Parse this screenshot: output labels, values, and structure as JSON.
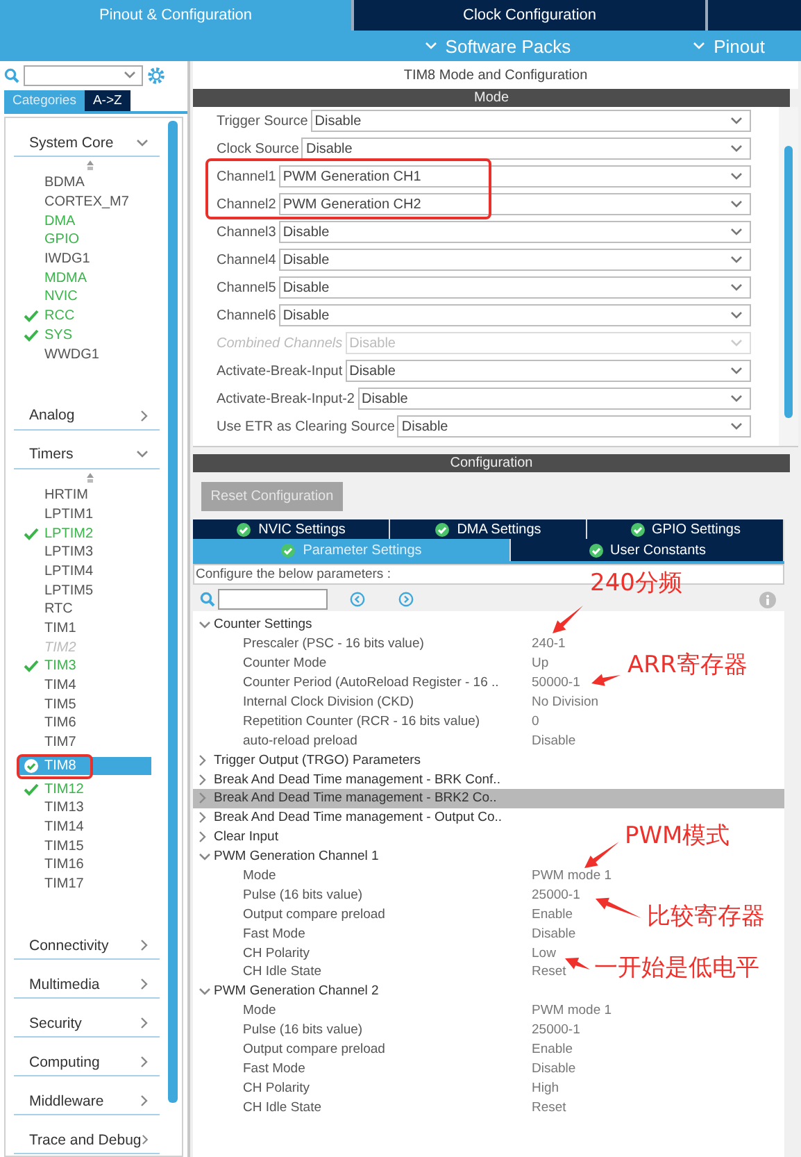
{
  "top_tabs": [
    {
      "label": "Pinout & Configuration",
      "selected": true
    },
    {
      "label": "Clock Configuration",
      "selected": false
    }
  ],
  "menu_bar": [
    "Software Packs",
    "Pinout"
  ],
  "sidebar": {
    "view_tabs": [
      {
        "label": "Categories",
        "selected": true
      },
      {
        "label": "A->Z",
        "selected": false
      }
    ],
    "categories": [
      {
        "name": "System Core",
        "expanded": true,
        "items": [
          {
            "label": "BDMA",
            "active": false,
            "checked": false,
            "disabled": false,
            "selected": false
          },
          {
            "label": "CORTEX_M7",
            "active": false,
            "checked": false,
            "disabled": false,
            "selected": false
          },
          {
            "label": "DMA",
            "active": true,
            "checked": false,
            "disabled": false,
            "selected": false
          },
          {
            "label": "GPIO",
            "active": true,
            "checked": false,
            "disabled": false,
            "selected": false
          },
          {
            "label": "IWDG1",
            "active": false,
            "checked": false,
            "disabled": false,
            "selected": false
          },
          {
            "label": "MDMA",
            "active": true,
            "checked": false,
            "disabled": false,
            "selected": false
          },
          {
            "label": "NVIC",
            "active": true,
            "checked": false,
            "disabled": false,
            "selected": false
          },
          {
            "label": "RCC",
            "active": true,
            "checked": true,
            "disabled": false,
            "selected": false
          },
          {
            "label": "SYS",
            "active": true,
            "checked": true,
            "disabled": false,
            "selected": false
          },
          {
            "label": "WWDG1",
            "active": false,
            "checked": false,
            "disabled": false,
            "selected": false
          }
        ]
      },
      {
        "name": "Analog",
        "expanded": false
      },
      {
        "name": "Timers",
        "expanded": true,
        "items": [
          {
            "label": "HRTIM",
            "active": false,
            "checked": false,
            "disabled": false,
            "selected": false
          },
          {
            "label": "LPTIM1",
            "active": false,
            "checked": false,
            "disabled": false,
            "selected": false
          },
          {
            "label": "LPTIM2",
            "active": true,
            "checked": true,
            "disabled": false,
            "selected": false
          },
          {
            "label": "LPTIM3",
            "active": false,
            "checked": false,
            "disabled": false,
            "selected": false
          },
          {
            "label": "LPTIM4",
            "active": false,
            "checked": false,
            "disabled": false,
            "selected": false
          },
          {
            "label": "LPTIM5",
            "active": false,
            "checked": false,
            "disabled": false,
            "selected": false
          },
          {
            "label": "RTC",
            "active": false,
            "checked": false,
            "disabled": false,
            "selected": false
          },
          {
            "label": "TIM1",
            "active": false,
            "checked": false,
            "disabled": false,
            "selected": false
          },
          {
            "label": "TIM2",
            "active": false,
            "checked": false,
            "disabled": true,
            "selected": false
          },
          {
            "label": "TIM3",
            "active": true,
            "checked": true,
            "disabled": false,
            "selected": false
          },
          {
            "label": "TIM4",
            "active": false,
            "checked": false,
            "disabled": false,
            "selected": false
          },
          {
            "label": "TIM5",
            "active": false,
            "checked": false,
            "disabled": false,
            "selected": false
          },
          {
            "label": "TIM6",
            "active": false,
            "checked": false,
            "disabled": false,
            "selected": false
          },
          {
            "label": "TIM7",
            "active": false,
            "checked": false,
            "disabled": false,
            "selected": false
          },
          {
            "label": "TIM8",
            "active": true,
            "checked": true,
            "disabled": false,
            "selected": true
          },
          {
            "label": "TIM12",
            "active": true,
            "checked": true,
            "disabled": false,
            "selected": false
          },
          {
            "label": "TIM13",
            "active": false,
            "checked": false,
            "disabled": false,
            "selected": false
          },
          {
            "label": "TIM14",
            "active": false,
            "checked": false,
            "disabled": false,
            "selected": false
          },
          {
            "label": "TIM15",
            "active": false,
            "checked": false,
            "disabled": false,
            "selected": false
          },
          {
            "label": "TIM16",
            "active": false,
            "checked": false,
            "disabled": false,
            "selected": false
          },
          {
            "label": "TIM17",
            "active": false,
            "checked": false,
            "disabled": false,
            "selected": false
          }
        ]
      },
      {
        "name": "Connectivity",
        "expanded": false
      },
      {
        "name": "Multimedia",
        "expanded": false
      },
      {
        "name": "Security",
        "expanded": false
      },
      {
        "name": "Computing",
        "expanded": false
      },
      {
        "name": "Middleware",
        "expanded": false
      },
      {
        "name": "Trace and Debug",
        "expanded": false
      }
    ]
  },
  "panel": {
    "title": "TIM8 Mode and Configuration",
    "mode_header": "Mode",
    "mode_rows": [
      {
        "label": "Trigger Source",
        "value": "Disable",
        "disabled": false
      },
      {
        "label": "Clock Source",
        "value": "Disable",
        "disabled": false
      },
      {
        "label": "Channel1",
        "value": "PWM Generation CH1",
        "disabled": false
      },
      {
        "label": "Channel2",
        "value": "PWM Generation CH2",
        "disabled": false
      },
      {
        "label": "Channel3",
        "value": "Disable",
        "disabled": false
      },
      {
        "label": "Channel4",
        "value": "Disable",
        "disabled": false
      },
      {
        "label": "Channel5",
        "value": "Disable",
        "disabled": false
      },
      {
        "label": "Channel6",
        "value": "Disable",
        "disabled": false
      },
      {
        "label": "Combined Channels",
        "value": "Disable",
        "disabled": true
      },
      {
        "label": "Activate-Break-Input",
        "value": "Disable",
        "disabled": false
      },
      {
        "label": "Activate-Break-Input-2",
        "value": "Disable",
        "disabled": false
      },
      {
        "label": "Use ETR as Clearing Source",
        "value": "Disable",
        "disabled": false
      }
    ],
    "config_header": "Configuration",
    "reset_button": {
      "label": "Reset Configuration",
      "disabled": true
    },
    "tab_rows": [
      [
        {
          "label": "NVIC Settings",
          "selected": false
        },
        {
          "label": "DMA Settings",
          "selected": false
        },
        {
          "label": "GPIO Settings",
          "selected": false
        }
      ],
      [
        {
          "label": "Parameter Settings",
          "selected": true
        },
        {
          "label": "User Constants",
          "selected": false
        }
      ]
    ],
    "hint": "Configure the below parameters :",
    "param_groups": [
      {
        "label": "Counter Settings",
        "expanded": true,
        "selected": false,
        "params": [
          {
            "label": "Prescaler (PSC - 16 bits value)",
            "value": "240-1"
          },
          {
            "label": "Counter Mode",
            "value": "Up"
          },
          {
            "label": "Counter Period (AutoReload Register - 16 ..",
            "value": "50000-1"
          },
          {
            "label": "Internal Clock Division (CKD)",
            "value": "No Division"
          },
          {
            "label": "Repetition Counter (RCR - 16 bits value)",
            "value": "0"
          },
          {
            "label": "auto-reload preload",
            "value": "Disable"
          }
        ]
      },
      {
        "label": "Trigger Output (TRGO) Parameters",
        "expanded": false,
        "selected": false
      },
      {
        "label": "Break And Dead Time management - BRK Conf..",
        "expanded": false,
        "selected": false
      },
      {
        "label": "Break And Dead Time management - BRK2 Co..",
        "expanded": false,
        "selected": true
      },
      {
        "label": "Break And Dead Time management - Output Co..",
        "expanded": false,
        "selected": false
      },
      {
        "label": "Clear Input",
        "expanded": false,
        "selected": false
      },
      {
        "label": "PWM Generation Channel 1",
        "expanded": true,
        "selected": false,
        "params": [
          {
            "label": "Mode",
            "value": "PWM mode 1"
          },
          {
            "label": "Pulse (16 bits value)",
            "value": "25000-1"
          },
          {
            "label": "Output compare preload",
            "value": "Enable"
          },
          {
            "label": "Fast Mode",
            "value": "Disable"
          },
          {
            "label": "CH Polarity",
            "value": "Low"
          },
          {
            "label": "CH Idle State",
            "value": "Reset"
          }
        ]
      },
      {
        "label": "PWM Generation Channel 2",
        "expanded": true,
        "selected": false,
        "params": [
          {
            "label": "Mode",
            "value": "PWM mode 1"
          },
          {
            "label": "Pulse (16 bits value)",
            "value": "25000-1"
          },
          {
            "label": "Output compare preload",
            "value": "Enable"
          },
          {
            "label": "Fast Mode",
            "value": "Disable"
          },
          {
            "label": "CH Polarity",
            "value": "High"
          },
          {
            "label": "CH Idle State",
            "value": "Reset"
          }
        ]
      }
    ]
  },
  "annotations": [
    {
      "kind": "box"
    },
    {
      "kind": "box"
    },
    {
      "kind": "note",
      "text": "240分频"
    },
    {
      "kind": "note",
      "text": "ARR寄存器"
    },
    {
      "kind": "note",
      "text": "PWM模式"
    },
    {
      "kind": "note",
      "text": "比较寄存器"
    },
    {
      "kind": "note",
      "text": "一开始是低电平"
    }
  ]
}
